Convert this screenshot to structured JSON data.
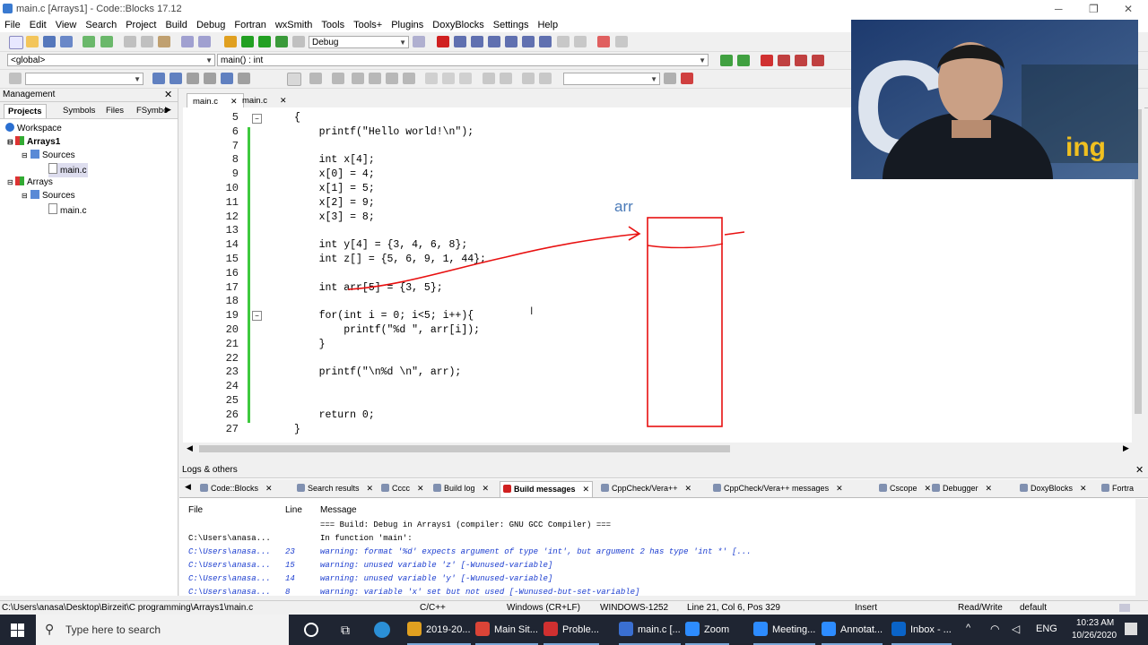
{
  "window": {
    "title": "main.c [Arrays1] - Code::Blocks 17.12",
    "controls": [
      "─",
      "❐",
      "✕"
    ]
  },
  "menu": [
    "File",
    "Edit",
    "View",
    "Search",
    "Project",
    "Build",
    "Debug",
    "Fortran",
    "wxSmith",
    "Tools",
    "Tools+",
    "Plugins",
    "DoxyBlocks",
    "Settings",
    "Help"
  ],
  "toolbar": {
    "build_target": "Debug",
    "scope": "<global>",
    "function": "main() : int"
  },
  "management": {
    "title": "Management",
    "tabs": [
      "Projects",
      "Symbols",
      "Files",
      "FSymbo"
    ],
    "tree": [
      {
        "label": "Workspace"
      },
      {
        "label": "Arrays1"
      },
      {
        "label": "Sources"
      },
      {
        "label": "main.c"
      },
      {
        "label": "Arrays"
      },
      {
        "label": "Sources"
      },
      {
        "label": "main.c"
      }
    ]
  },
  "editor": {
    "tabs": [
      "main.c",
      "main.c"
    ],
    "lines": [
      {
        "n": "5",
        "t": "{"
      },
      {
        "n": "6",
        "t": "    printf(\"Hello world!\\n\");"
      },
      {
        "n": "7",
        "t": ""
      },
      {
        "n": "8",
        "t": "    int x[4];"
      },
      {
        "n": "9",
        "t": "    x[0] = 4;"
      },
      {
        "n": "10",
        "t": "    x[1] = 5;"
      },
      {
        "n": "11",
        "t": "    x[2] = 9;"
      },
      {
        "n": "12",
        "t": "    x[3] = 8;"
      },
      {
        "n": "13",
        "t": ""
      },
      {
        "n": "14",
        "t": "    int y[4] = {3, 4, 6, 8};"
      },
      {
        "n": "15",
        "t": "    int z[] = {5, 6, 9, 1, 44};"
      },
      {
        "n": "16",
        "t": ""
      },
      {
        "n": "17",
        "t": "    int arr[5] = {3, 5};"
      },
      {
        "n": "18",
        "t": ""
      },
      {
        "n": "19",
        "t": "    for(int i = 0; i<5; i++){"
      },
      {
        "n": "20",
        "t": "        printf(\"%d \", arr[i]);"
      },
      {
        "n": "21",
        "t": "    }"
      },
      {
        "n": "22",
        "t": ""
      },
      {
        "n": "23",
        "t": "    printf(\"\\n%d \\n\", arr);"
      },
      {
        "n": "24",
        "t": ""
      },
      {
        "n": "25",
        "t": ""
      },
      {
        "n": "26",
        "t": "    return 0;"
      },
      {
        "n": "27",
        "t": "}"
      }
    ],
    "annotation": {
      "label": "arr",
      "color": "#e81010"
    }
  },
  "logs": {
    "title": "Logs & others",
    "tabs": [
      "Code::Blocks",
      "Search results",
      "Cccc",
      "Build log",
      "Build messages",
      "CppCheck/Vera++",
      "CppCheck/Vera++ messages",
      "Cscope",
      "Debugger",
      "DoxyBlocks",
      "Fortra"
    ],
    "active_tab": "Build messages",
    "columns": [
      "File",
      "Line",
      "Message"
    ],
    "rows": [
      {
        "file": "",
        "line": "",
        "msg": "=== Build: Debug in Arrays1 (compiler: GNU GCC Compiler) ===",
        "warn": false
      },
      {
        "file": "C:\\Users\\anasa...",
        "line": "",
        "msg": "In function 'main':",
        "warn": false
      },
      {
        "file": "C:\\Users\\anasa...",
        "line": "23",
        "msg": "warning: format '%d' expects argument of type 'int', but argument 2 has type 'int *' [...",
        "warn": true
      },
      {
        "file": "C:\\Users\\anasa...",
        "line": "15",
        "msg": "warning: unused variable 'z' [-Wunused-variable]",
        "warn": true
      },
      {
        "file": "C:\\Users\\anasa...",
        "line": "14",
        "msg": "warning: unused variable 'y' [-Wunused-variable]",
        "warn": true
      },
      {
        "file": "C:\\Users\\anasa...",
        "line": "8",
        "msg": "warning: variable 'x' set but not used [-Wunused-but-set-variable]",
        "warn": true
      }
    ]
  },
  "status": {
    "path": "C:\\Users\\anasa\\Desktop\\Birzeit\\C programming\\Arrays1\\main.c",
    "lang": "C/C++",
    "eol": "Windows (CR+LF)",
    "encoding": "WINDOWS-1252",
    "position": "Line 21, Col 6, Pos 329",
    "mode": "Insert",
    "access": "Read/Write",
    "profile": "default"
  },
  "taskbar": {
    "search_placeholder": "Type here to search",
    "apps": [
      "2019-20...",
      "Main Sit...",
      "Proble...",
      "main.c [...",
      "Zoom",
      "Meeting...",
      "Annotat...",
      "Inbox - ..."
    ],
    "lang": "ENG",
    "time": "10:23 AM",
    "date": "10/26/2020"
  },
  "webcam": {
    "overlay_text": "ing"
  }
}
